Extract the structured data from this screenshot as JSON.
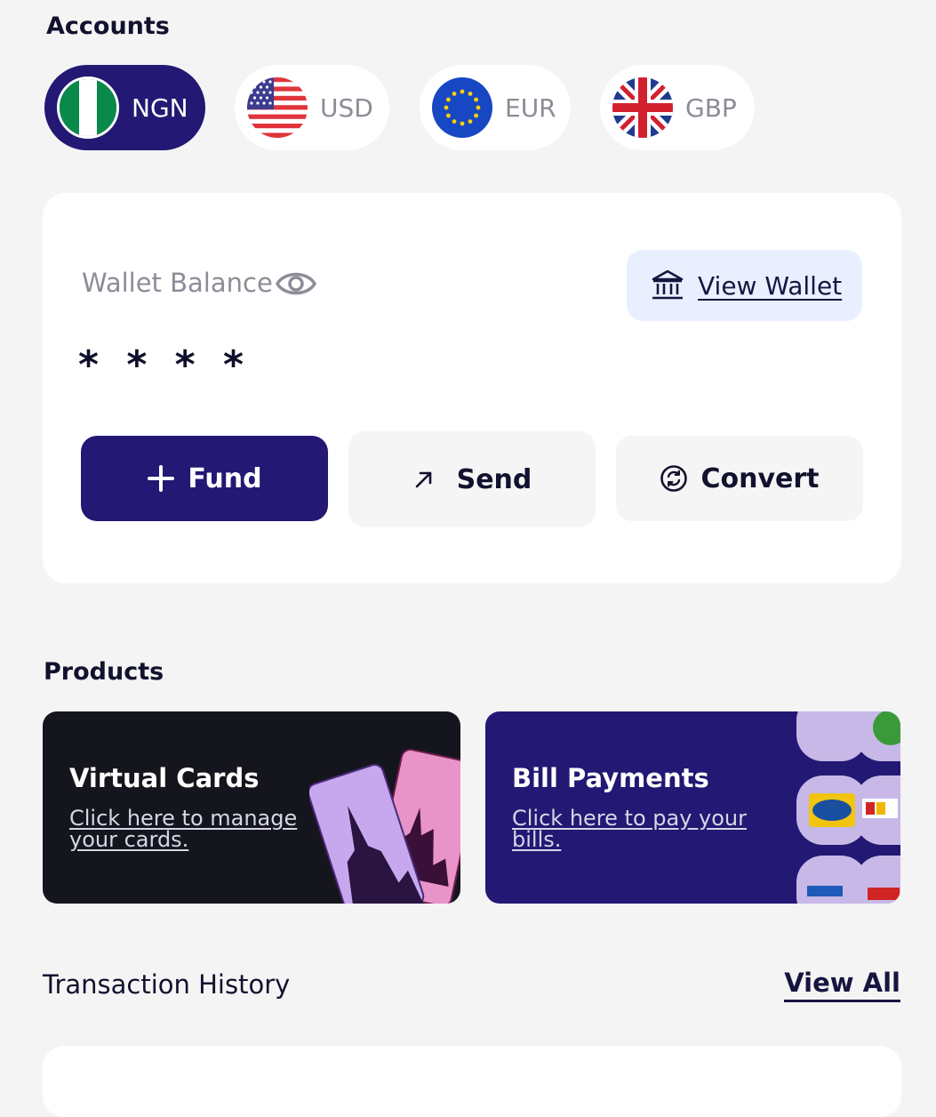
{
  "accounts": {
    "title": "Accounts",
    "currencies": [
      {
        "code": "NGN",
        "active": true
      },
      {
        "code": "USD",
        "active": false
      },
      {
        "code": "EUR",
        "active": false
      },
      {
        "code": "GBP",
        "active": false
      }
    ]
  },
  "wallet": {
    "balance_label": "Wallet Balance",
    "balance_value": "* * * *",
    "view_wallet_label": "View Wallet",
    "actions": {
      "fund": "Fund",
      "send": "Send",
      "convert": "Convert"
    }
  },
  "products": {
    "title": "Products",
    "items": [
      {
        "title": "Virtual Cards",
        "link": "Click here to manage your cards."
      },
      {
        "title": "Bill Payments",
        "link": "Click here to pay your bills."
      }
    ]
  },
  "transactions": {
    "title": "Transaction History",
    "view_all": "View All"
  },
  "colors": {
    "primary": "#231873",
    "background": "#f4f4f4",
    "card": "#ffffff",
    "view_wallet_bg": "#e9efff"
  },
  "icons": [
    "eye-icon",
    "bank-icon",
    "plus-icon",
    "arrow-up-right-icon",
    "convert-icon"
  ]
}
